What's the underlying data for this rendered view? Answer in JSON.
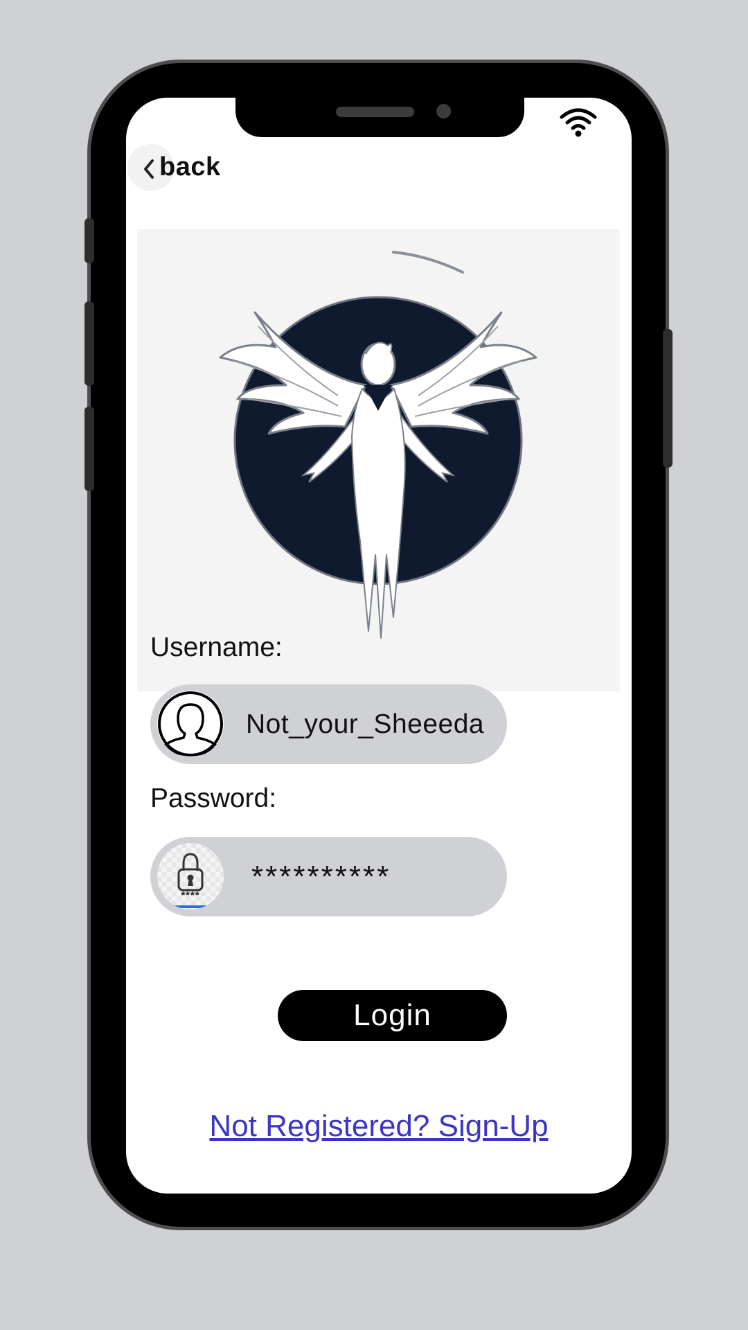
{
  "status_bar": {
    "wifi_icon": "wifi-icon"
  },
  "nav": {
    "back_label": "back",
    "back_icon": "chevron-left-icon"
  },
  "logo": {
    "icon": "winged-figure-logo",
    "colors": {
      "dark": "#0f1a2e",
      "background": "#f4f4f4"
    }
  },
  "form": {
    "username_label": "Username:",
    "username_value": "Not_your_Sheeeda",
    "username_icon": "user-avatar-icon",
    "password_label": "Password:",
    "password_value": "**********",
    "password_icon": "padlock-icon",
    "password_icon_caption": "****"
  },
  "actions": {
    "login_label": "Login",
    "signup_link": "Not Registered? Sign-Up"
  },
  "theme": {
    "background": "#d0d1d5",
    "field_background": "#d0d1d5",
    "button_background": "#000000",
    "link_color": "#3b34c6"
  }
}
